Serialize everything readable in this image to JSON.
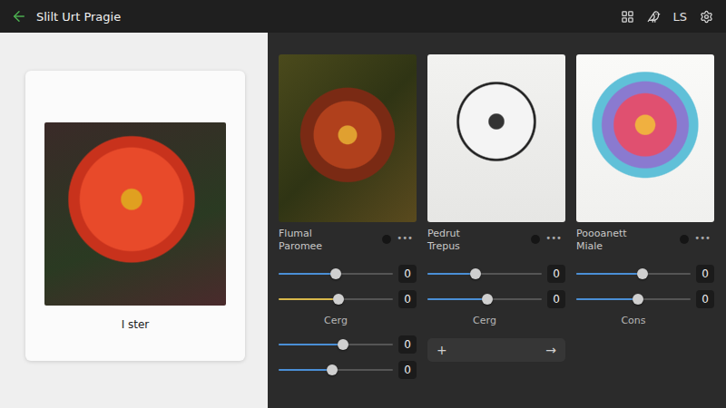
{
  "window": {
    "title": "Slilt Urt Pragie"
  },
  "toolbar": {
    "badge": "LS"
  },
  "source": {
    "caption": "I ster"
  },
  "styles": [
    {
      "title": "Flumal Paromee",
      "menu": "•••",
      "controls": [
        {
          "kind": "slider",
          "level": 0.5,
          "value": "0",
          "color": "#4a8fd6"
        },
        {
          "kind": "slider",
          "level": 0.52,
          "value": "0",
          "color": "#d8b84a"
        },
        {
          "kind": "label",
          "text": "Cerg"
        },
        {
          "kind": "slider",
          "level": 0.56,
          "value": "0",
          "color": "#4a8fd6"
        },
        {
          "kind": "slider",
          "level": 0.47,
          "value": "0",
          "color": "#4a8fd6"
        }
      ]
    },
    {
      "title": "Pedrut Trepus",
      "menu": "•••",
      "controls": [
        {
          "kind": "slider",
          "level": 0.42,
          "value": "0",
          "color": "#4a8fd6"
        },
        {
          "kind": "slider",
          "level": 0.52,
          "value": "0",
          "color": "#4a8fd6"
        },
        {
          "kind": "label",
          "text": "Cerg"
        },
        {
          "kind": "add-row",
          "add": "+",
          "go": "→"
        }
      ]
    },
    {
      "title": "Poooanett Miale",
      "menu": "•••",
      "controls": [
        {
          "kind": "slider",
          "level": 0.58,
          "value": "0",
          "color": "#4a8fd6"
        },
        {
          "kind": "slider",
          "level": 0.54,
          "value": "0",
          "color": "#4a8fd6"
        },
        {
          "kind": "label",
          "text": "Cons"
        }
      ]
    }
  ]
}
